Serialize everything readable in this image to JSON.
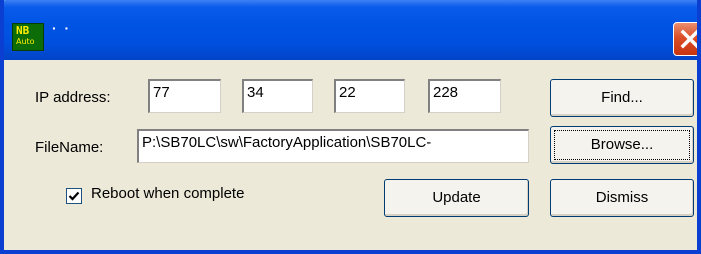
{
  "window": {
    "title": "· ·",
    "icon": {
      "name": "nb-auto-app-icon",
      "line1": "NB",
      "line2": "Auto"
    },
    "close_icon": "close-x-icon"
  },
  "form": {
    "ip_label": "IP address:",
    "ip_octets": [
      "77",
      "34",
      "22",
      "228"
    ],
    "filename_label": "FileName:",
    "filename_value": "P:\\SB70LC\\sw\\FactoryApplication\\SB70LC-",
    "reboot_label": "Reboot when complete",
    "reboot_checked": true
  },
  "buttons": {
    "find": "Find...",
    "browse": "Browse...",
    "update": "Update",
    "dismiss": "Dismiss"
  },
  "colors": {
    "titlebar": "#0054e3",
    "close": "#db4e28",
    "dialog_bg": "#ece9d8"
  }
}
